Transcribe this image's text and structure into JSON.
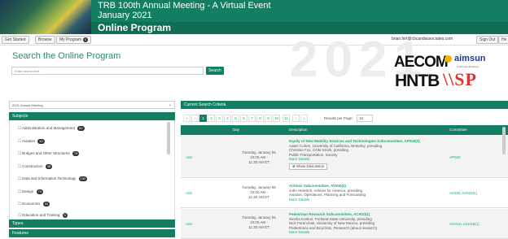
{
  "header": {
    "title": "TRB 100th Annual Meeting - A Virtual Event",
    "subtitle": "January 2021",
    "program": "Online Program"
  },
  "nav": {
    "get_started": "Get Started",
    "browse": "Browse",
    "my_program": "My Program",
    "my_program_count": "0",
    "email": "brian.hirt@cbcandassociates.com",
    "sign_out": "Sign Out",
    "help": "He"
  },
  "search": {
    "title": "Search the Online Program",
    "placeholder": "Enter search text",
    "button": "Search"
  },
  "hero": {
    "year": "2021"
  },
  "sponsors": {
    "aecom": "AECOM",
    "aimsun": "aimsun",
    "aimsun_sub": "A Siemens Business",
    "hntb": "HNTB",
    "wsp": "\\\\SP"
  },
  "left_panel": {
    "meeting_select": "2021 Annual Meeting",
    "subjects_header": "Subjects",
    "subjects": [
      {
        "label": "Administration and Management",
        "count": "60"
      },
      {
        "label": "Aviation",
        "count": "40"
      },
      {
        "label": "Bridges and Other Structures",
        "count": "78"
      },
      {
        "label": "Construction",
        "count": "38"
      },
      {
        "label": "Data and Information Technology",
        "count": "192"
      },
      {
        "label": "Design",
        "count": "73"
      },
      {
        "label": "Economics",
        "count": "33"
      },
      {
        "label": "Education and Training",
        "count": "9"
      }
    ],
    "types_header": "Types",
    "features_header": "Features"
  },
  "right_panel": {
    "criteria_header": "Current Search Criteria",
    "pager": {
      "pages": [
        "«",
        "‹",
        "1",
        "2",
        "3",
        "4",
        "5",
        "6",
        "7",
        "8",
        "9",
        "10",
        "11",
        "›",
        "»"
      ],
      "active_page": "1",
      "results_label": "Results per Page:",
      "results_value": "10"
    },
    "columns": [
      "",
      "Day",
      "Description",
      "Committee"
    ],
    "rows": [
      {
        "id": "A02",
        "day": "Tuesday, January 05",
        "time1": "10:00 AM -",
        "time2": "11:30 AM ET",
        "title": "Equity of New Mobility Services and Technologies Subcommittee, AP020(3)",
        "lines": [
          "Adam Cohen, University of California, Berkeley, presiding",
          "Christine Fox, COM Smith, presiding",
          "Public Transportation, Society"
        ],
        "more": "More Details",
        "show_btn": "Show Discussion",
        "committee": "AP020"
      },
      {
        "id": "A02",
        "day": "Tuesday, January 05",
        "time1": "10:00 AM -",
        "time2": "11:30 AM ET",
        "title": "Airlines Subcommittee, AV030(4)",
        "lines": [
          "John Heimlich, Airlines for America, presiding",
          "Aviation, Operations, Planning and Forecasting"
        ],
        "more": "More Details",
        "show_btn": "",
        "committee": "AV030, AV010(1)"
      },
      {
        "id": "A02",
        "day": "Tuesday, January 05",
        "time1": "10:00 AM -",
        "time2": "11:30 AM ET",
        "title": "Pedestrian Research Subcommittee, ACH10(1)",
        "lines": [
          "Sirisha Kothuri, Portland State University, presiding",
          "Nick Ferenchak, University of New Mexico, presiding",
          "Pedestrians and Bicyclists, Research (about research)"
        ],
        "more": "More Details",
        "show_btn": "",
        "committee": "ACH10, ACH10(1)"
      }
    ]
  },
  "colors": {
    "accent": "#137e62",
    "link": "#22aa66"
  }
}
